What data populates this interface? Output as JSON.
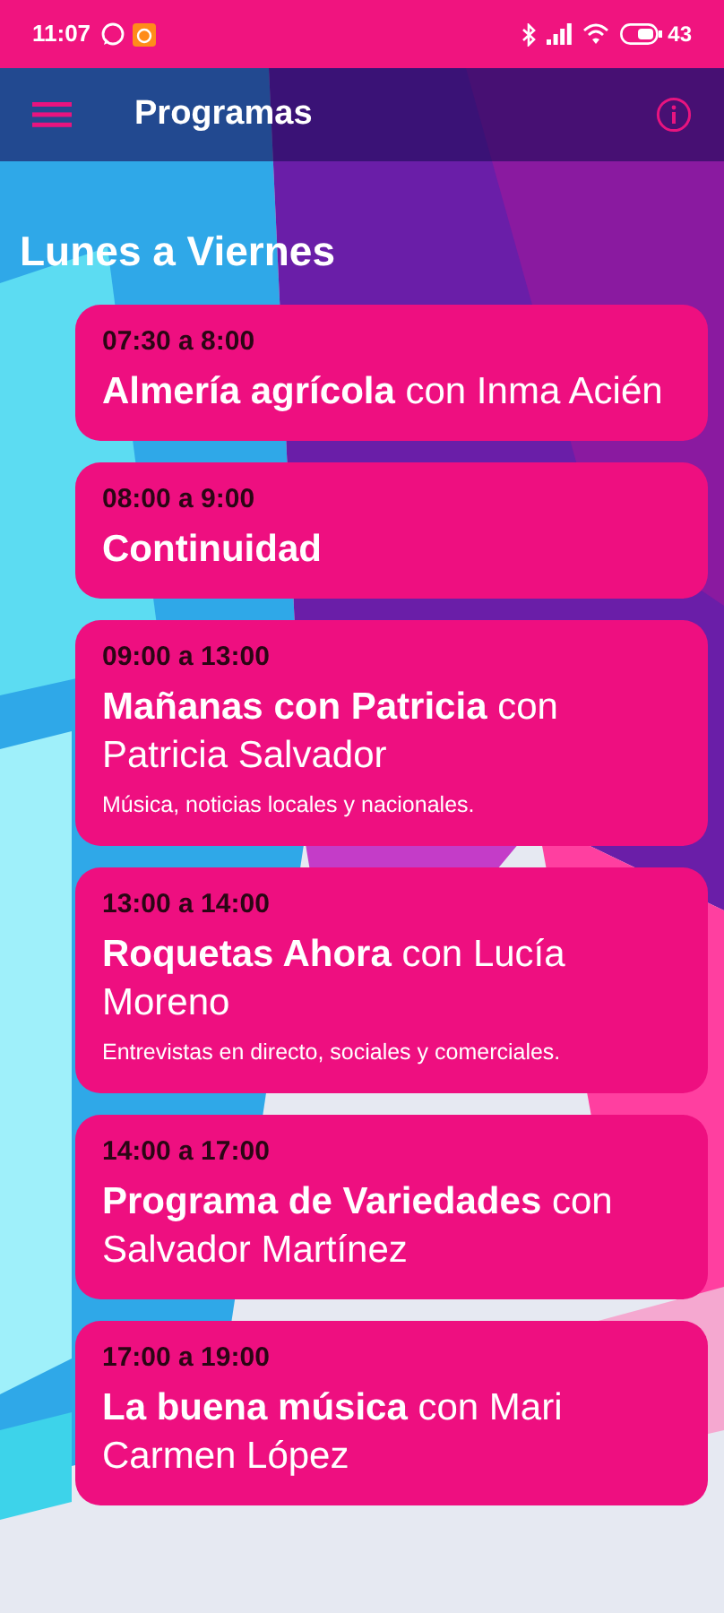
{
  "status_bar": {
    "time": "11:07",
    "battery": "43"
  },
  "app_bar": {
    "title": "Programas"
  },
  "section_title": "Lunes a Viernes",
  "programs": [
    {
      "time": "07:30 a 8:00",
      "title": "**Almería agrícola** con Inma Acién"
    },
    {
      "time": "08:00 a 9:00",
      "title": "**Continuidad**"
    },
    {
      "time": "09:00 a 13:00",
      "title": "**Mañanas con Patricia** con Patricia Salvador",
      "description": "Música, noticias locales y nacionales."
    },
    {
      "time": "13:00 a 14:00",
      "title": "**Roquetas Ahora** con Lucía Moreno",
      "description": "Entrevistas en directo, sociales y comerciales."
    },
    {
      "time": "14:00 a 17:00",
      "title": "**Programa de Variedades** con Salvador Martínez"
    },
    {
      "time": "17:00 a 19:00",
      "title": "**La buena música** con Mari Carmen López"
    }
  ]
}
